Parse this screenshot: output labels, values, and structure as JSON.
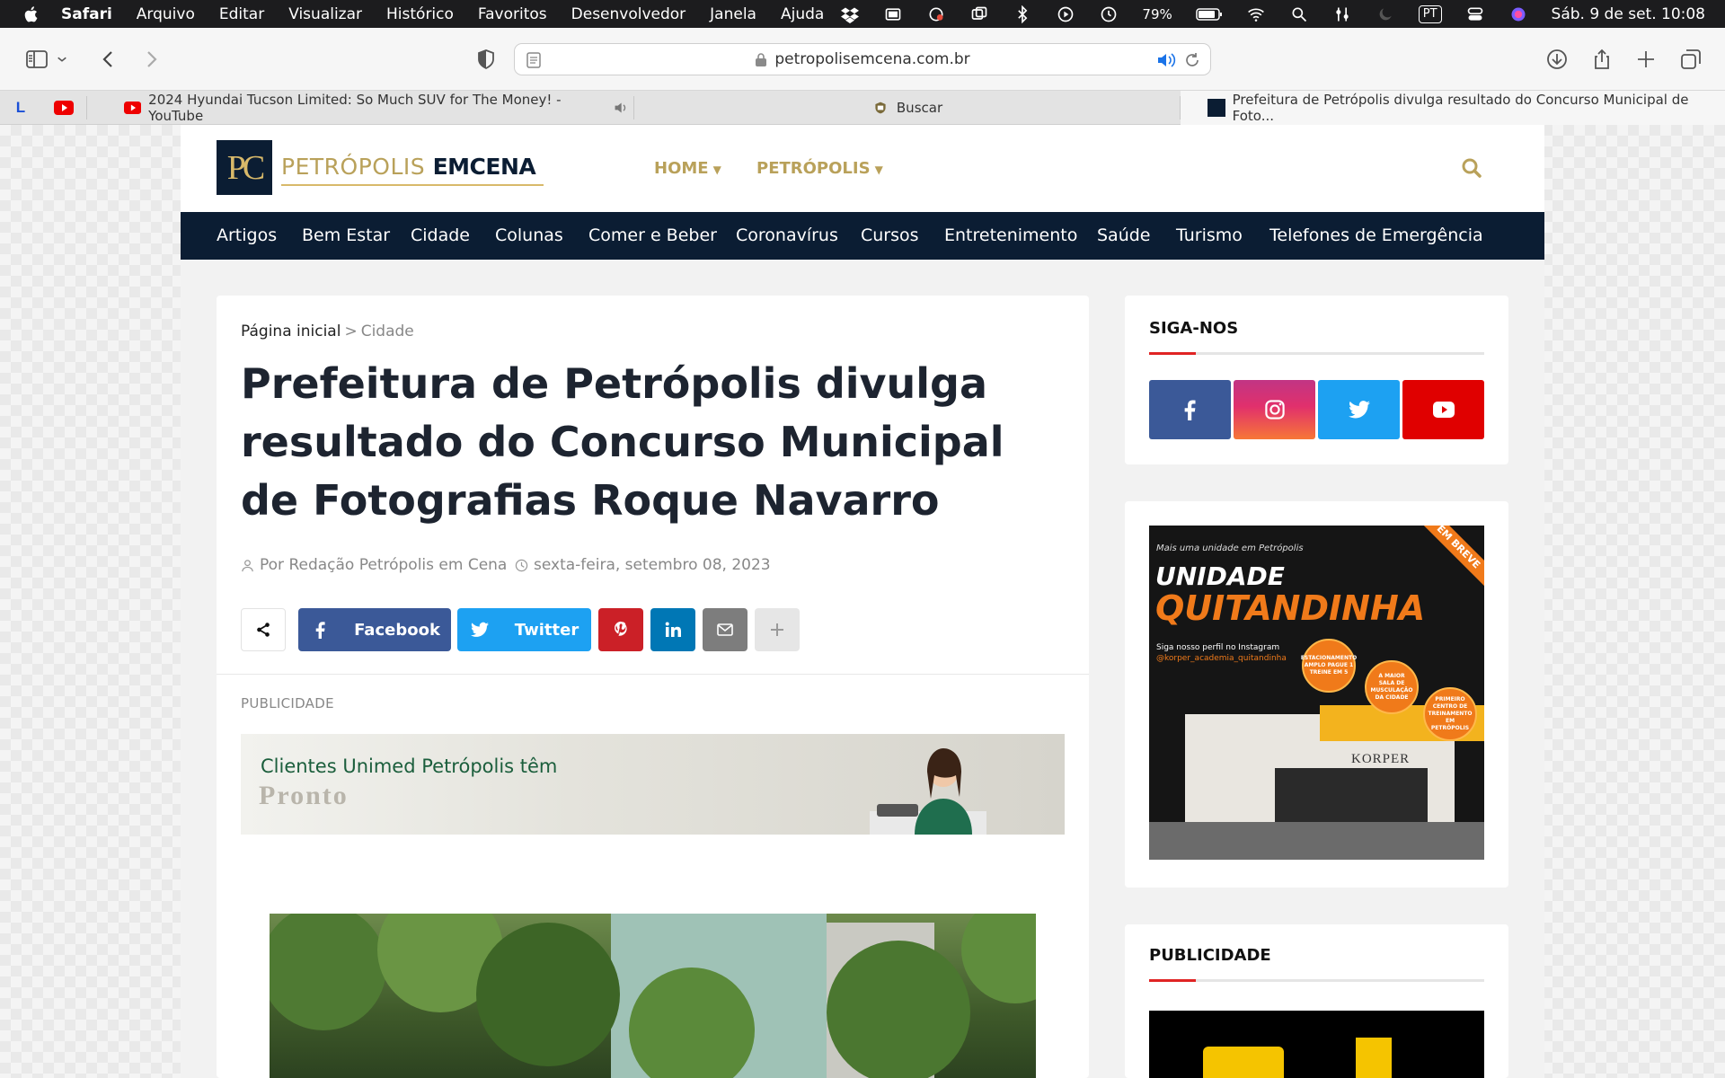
{
  "menubar": {
    "app": "Safari",
    "items": [
      "Arquivo",
      "Editar",
      "Visualizar",
      "Histórico",
      "Favoritos",
      "Desenvolvedor",
      "Janela",
      "Ajuda"
    ],
    "battery": "79%",
    "input_source": "PT",
    "clock": "Sáb. 9 de set.  10:08"
  },
  "browser": {
    "url": "petropolisemcena.com.br",
    "tabs": [
      {
        "title": "2024 Hyundai Tucson Limited: So Much SUV for The Money! - YouTube"
      },
      {
        "title": "Buscar"
      },
      {
        "title": "Prefeitura de Petrópolis divulga resultado do Concurso Municipal de Foto..."
      }
    ],
    "pinned": [
      "L",
      "youtube"
    ]
  },
  "site": {
    "logo_mark": "PC",
    "logo_light": "PETRÓPOLIS ",
    "logo_bold": "EMCENA",
    "top_nav": [
      "HOME",
      "PETRÓPOLIS"
    ],
    "categories": [
      "Artigos",
      "Bem Estar",
      "Cidade",
      "Colunas",
      "Comer e Beber",
      "Coronavírus",
      "Cursos",
      "Entretenimento",
      "Saúde",
      "Turismo",
      "Telefones de Emergência"
    ]
  },
  "article": {
    "breadcrumb_home": "Página inicial",
    "breadcrumb_sep": ">",
    "breadcrumb_current": "Cidade",
    "title": "Prefeitura de Petrópolis divulga resultado do Concurso Municipal de Fotografias Roque Navarro",
    "author": "Por Redação Petrópolis em Cena",
    "date": "sexta-feira, setembro 08, 2023",
    "share": {
      "facebook": "Facebook",
      "twitter": "Twitter"
    },
    "ad_label": "PUBLICIDADE",
    "ad_line1": "Clientes Unimed Petrópolis têm",
    "ad_line2": "Pronto"
  },
  "sidebar": {
    "follow_title": "SIGA-NOS",
    "social": [
      {
        "name": "facebook",
        "color": "#3b5998"
      },
      {
        "name": "instagram",
        "color": "#c13584"
      },
      {
        "name": "twitter",
        "color": "#1da1f2"
      },
      {
        "name": "youtube",
        "color": "#e00000"
      }
    ],
    "ad": {
      "small": "Mais uma unidade em Petrópolis",
      "line1": "UNIDADE",
      "line2": "QUITANDINHA",
      "ribbon": "EM BREVE",
      "insta1": "Siga nosso perfil no Instagram",
      "insta2": "@korper_academia_quitandinha",
      "badge1": "ESTACIONAMENTO AMPLO PAGUE 1 TREINE EM 5",
      "badge2": "A MAIOR SALA DE MUSCULAÇÃO DA CIDADE",
      "badge3": "PRIMEIRO CENTRO DE TREINAMENTO EM PETRÓPOLIS",
      "brand": "KORPER"
    },
    "pub_title": "PUBLICIDADE"
  }
}
